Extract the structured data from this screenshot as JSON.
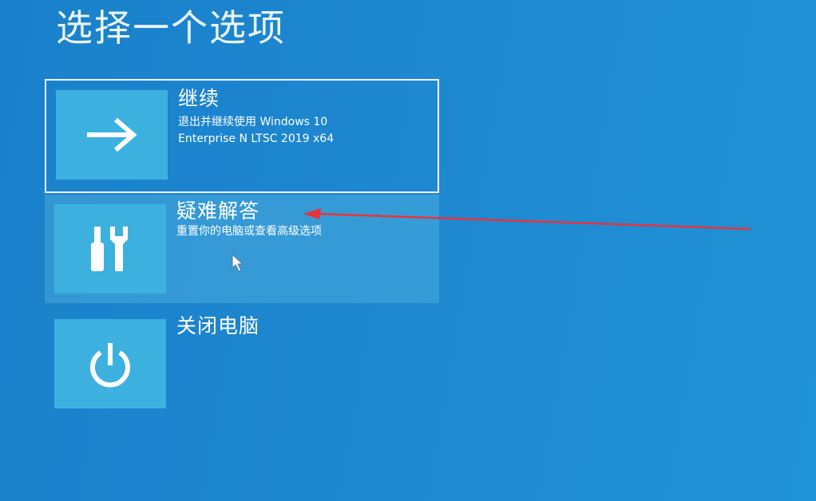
{
  "page": {
    "title": "选择一个选项"
  },
  "options": [
    {
      "title": "继续",
      "desc_line1": "退出并继续使用 Windows 10",
      "desc_line2": "Enterprise N LTSC 2019 x64",
      "icon": "arrow-right-icon",
      "state": "selected"
    },
    {
      "title": "疑难解答",
      "desc_line1": "重置你的电脑或查看高级选项",
      "icon": "tools-icon",
      "state": "hover"
    },
    {
      "title": "关闭电脑",
      "icon": "power-icon",
      "state": "normal"
    }
  ],
  "colors": {
    "background": "#1f86cf",
    "tile": "#3cb1e0",
    "annotation_arrow": "#e8323c"
  }
}
